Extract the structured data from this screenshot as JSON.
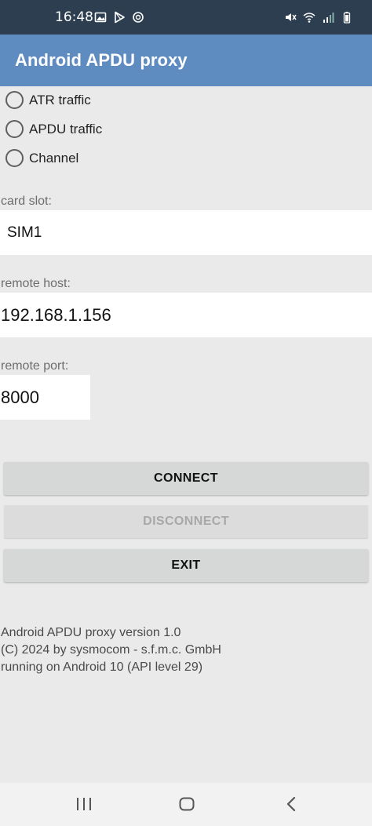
{
  "status_bar": {
    "time": "16:48",
    "left_icons": [
      "image-icon",
      "play-store-icon",
      "sync-icon"
    ],
    "right_icons": [
      "mute-icon",
      "wifi-icon",
      "signal-icon",
      "battery-icon"
    ]
  },
  "app_bar": {
    "title": "Android APDU proxy",
    "color": "#5e8bc0"
  },
  "radios": [
    {
      "label": "ATR traffic",
      "checked": false
    },
    {
      "label": "APDU traffic",
      "checked": false
    },
    {
      "label": "Channel",
      "checked": false
    }
  ],
  "fields": {
    "card_slot": {
      "label": "card slot:",
      "value": "SIM1"
    },
    "remote_host": {
      "label": "remote host:",
      "value": "192.168.1.156"
    },
    "remote_port": {
      "label": "remote port:",
      "value": "8000"
    }
  },
  "buttons": {
    "connect": "CONNECT",
    "disconnect": "DISCONNECT",
    "exit": "EXIT"
  },
  "info": {
    "version": "Android APDU proxy version 1.0",
    "copyright": "(C) 2024 by sysmocom - s.f.m.c. GmbH",
    "platform": "running on Android 10 (API level 29)"
  },
  "nav_bar": {
    "icons": [
      "recent-apps-icon",
      "home-icon",
      "back-icon"
    ]
  }
}
